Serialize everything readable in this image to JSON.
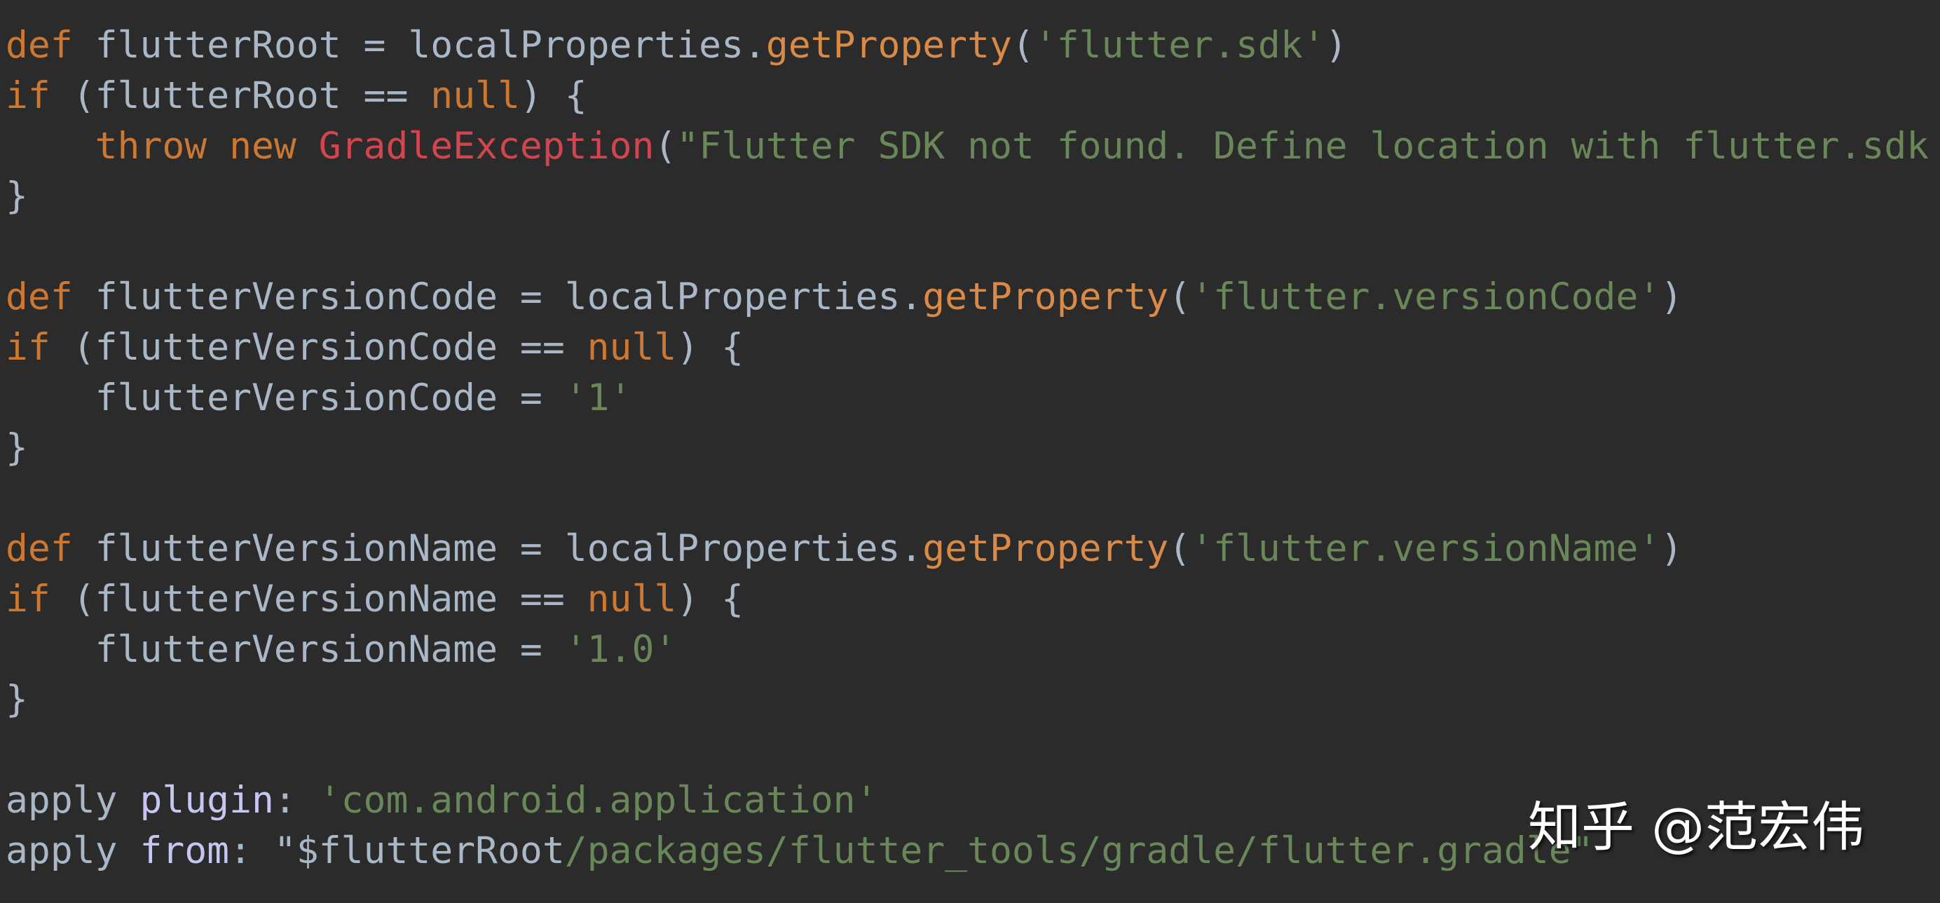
{
  "colors": {
    "background": "#2b2b2b",
    "plain": "#a9b7c6",
    "keyword": "#cc7832",
    "method": "#d98a46",
    "class": "#d2454f",
    "string": "#6a8759",
    "identifier": "#c6c6f2"
  },
  "code": {
    "lines": [
      [
        [
          "def",
          "kw"
        ],
        [
          " flutterRoot = localProperties.",
          "plain"
        ],
        [
          "getProperty",
          "method"
        ],
        [
          "(",
          "plain"
        ],
        [
          "'flutter.sdk'",
          "str"
        ],
        [
          ")",
          "plain"
        ]
      ],
      [
        [
          "if",
          "kw"
        ],
        [
          " (flutterRoot == ",
          "plain"
        ],
        [
          "null",
          "kw"
        ],
        [
          ") {",
          "plain"
        ]
      ],
      [
        [
          "    ",
          "plain"
        ],
        [
          "throw new ",
          "kw"
        ],
        [
          "GradleException",
          "class"
        ],
        [
          "(",
          "plain"
        ],
        [
          "\"Flutter SDK not found. Define location with flutter.sdk in the local.properties file.\"",
          "str"
        ],
        [
          ")",
          "plain"
        ]
      ],
      [
        [
          "}",
          "plain"
        ]
      ],
      [],
      [
        [
          "def",
          "kw"
        ],
        [
          " flutterVersionCode = localProperties.",
          "plain"
        ],
        [
          "getProperty",
          "method"
        ],
        [
          "(",
          "plain"
        ],
        [
          "'flutter.versionCode'",
          "str"
        ],
        [
          ")",
          "plain"
        ]
      ],
      [
        [
          "if",
          "kw"
        ],
        [
          " (flutterVersionCode == ",
          "plain"
        ],
        [
          "null",
          "kw"
        ],
        [
          ") {",
          "plain"
        ]
      ],
      [
        [
          "    flutterVersionCode = ",
          "plain"
        ],
        [
          "'1'",
          "str"
        ]
      ],
      [
        [
          "}",
          "plain"
        ]
      ],
      [],
      [
        [
          "def",
          "kw"
        ],
        [
          " flutterVersionName = localProperties.",
          "plain"
        ],
        [
          "getProperty",
          "method"
        ],
        [
          "(",
          "plain"
        ],
        [
          "'flutter.versionName'",
          "str"
        ],
        [
          ")",
          "plain"
        ]
      ],
      [
        [
          "if",
          "kw"
        ],
        [
          " (flutterVersionName == ",
          "plain"
        ],
        [
          "null",
          "kw"
        ],
        [
          ") {",
          "plain"
        ]
      ],
      [
        [
          "    flutterVersionName = ",
          "plain"
        ],
        [
          "'1.0'",
          "str"
        ]
      ],
      [
        [
          "}",
          "plain"
        ]
      ],
      [],
      [
        [
          "apply ",
          "plain"
        ],
        [
          "plugin",
          "ident"
        ],
        [
          ": ",
          "plain"
        ],
        [
          "'com.android.application'",
          "str"
        ]
      ],
      [
        [
          "apply ",
          "plain"
        ],
        [
          "from",
          "ident"
        ],
        [
          ": ",
          "plain"
        ],
        [
          "\"$flutterRoot",
          "plain"
        ],
        [
          "/packages/flutter_tools/gradle/flutter.gradle\"",
          "str"
        ]
      ]
    ]
  },
  "watermark": "知乎 @范宏伟"
}
